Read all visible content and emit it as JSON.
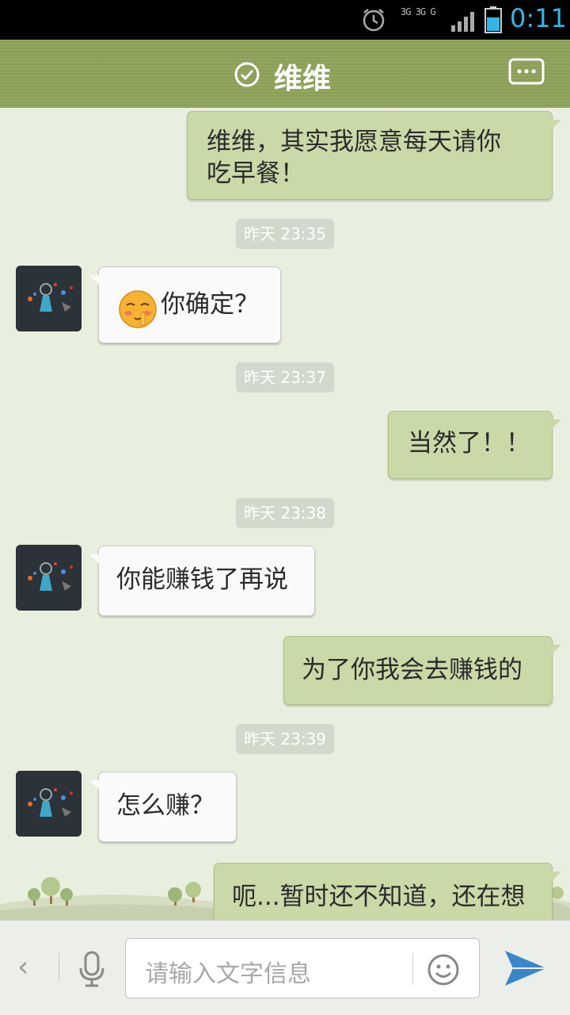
{
  "status_bar": {
    "network_labels": [
      "3G",
      "3G",
      "G"
    ],
    "time": "0:11"
  },
  "header": {
    "title": "维维",
    "verified_icon": "check-circle-icon",
    "more_icon": "chat-bubble-more-icon"
  },
  "messages": [
    {
      "type": "out",
      "text_lines": [
        "维维，其实我愿意每天请你",
        "吃早餐！"
      ]
    },
    {
      "type": "time",
      "text": "昨天 23:35"
    },
    {
      "type": "in",
      "emoji": "shy-face",
      "text": "你确定？"
    },
    {
      "type": "time",
      "text": "昨天 23:37"
    },
    {
      "type": "out",
      "text": "当然了！！"
    },
    {
      "type": "time",
      "text": "昨天 23:38"
    },
    {
      "type": "in",
      "text": "你能赚钱了再说"
    },
    {
      "type": "out",
      "text": "为了你我会去赚钱的"
    },
    {
      "type": "time",
      "text": "昨天 23:39"
    },
    {
      "type": "in",
      "text": "怎么赚？"
    },
    {
      "type": "out",
      "text": "呃...暂时还不知道，还在想"
    }
  ],
  "input": {
    "placeholder": "请输入文字信息",
    "back_icon": "chevron-left-icon",
    "mic_icon": "microphone-icon",
    "emoji_icon": "smiley-icon",
    "send_icon": "send-arrow-icon"
  },
  "colors": {
    "header": "#8ea35a",
    "background": "#e9efdf",
    "outgoing_bubble": "#c9d9a8",
    "incoming_bubble": "#fafafa",
    "clock": "#33b5e5"
  }
}
